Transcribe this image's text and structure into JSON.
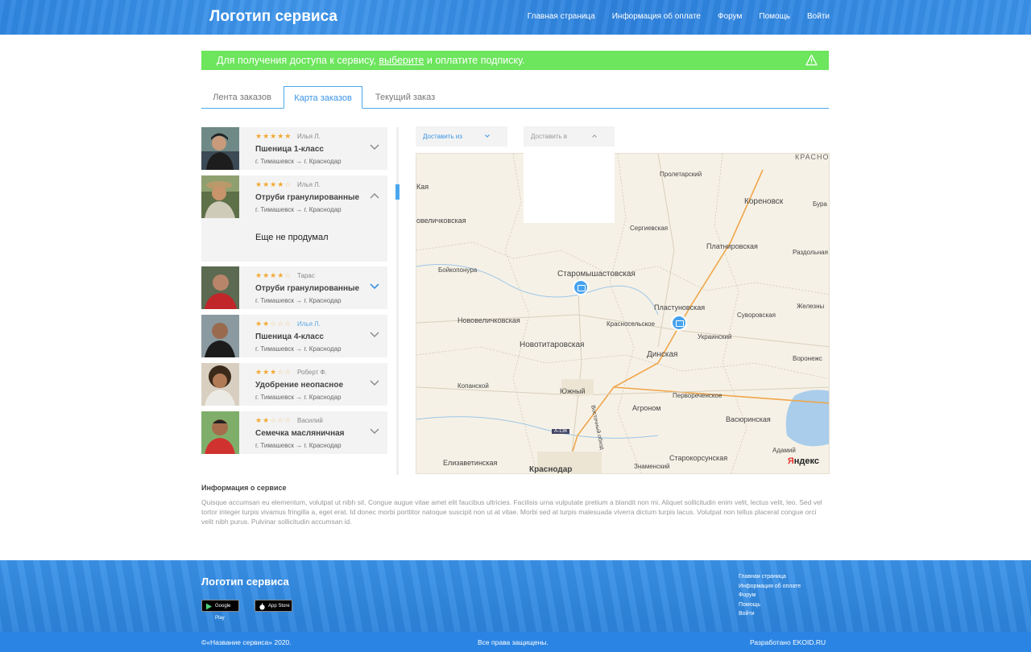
{
  "header": {
    "logo": "Логотип сервиса",
    "nav": [
      "Главная страница",
      "Информация об оплате",
      "Форум",
      "Помощь",
      "Войти"
    ]
  },
  "alert": {
    "text_before": "Для получения доступа к сервису, ",
    "link": "выберите",
    "text_after": " и оплатите подписку.",
    "icon": "warning-icon"
  },
  "tabs": [
    "Лента заказов",
    "Карта заказов",
    "Текущий заказ"
  ],
  "active_tab": "Карта заказов",
  "orders": [
    {
      "rating": 5,
      "author": "Илья Л.",
      "cargo": "Пшеница 1-класс",
      "from": "г. Тимашевск",
      "to": "г. Краснодар",
      "expanded": false
    },
    {
      "rating": 4,
      "author": "Илья Л.",
      "cargo": "Отруби гранулированные",
      "from": "г. Тимашевск",
      "to": "г. Краснодар",
      "expanded": true,
      "note": "Еще не продумал"
    },
    {
      "rating": 4,
      "author": "Тарас",
      "cargo": "Отруби гранулированные",
      "from": "г. Тимашевск",
      "to": "г. Краснодар",
      "expanded": false
    },
    {
      "rating": 2,
      "author": "Илья Л.",
      "cargo": "Пшеница 4-класс",
      "from": "г. Тимашевск",
      "to": "г. Краснодар",
      "expanded": false
    },
    {
      "rating": 3,
      "author": "Роберт Ф.",
      "cargo": "Удобрение неопасное",
      "from": "г. Тимашевск",
      "to": "г. Краснодар",
      "expanded": false
    },
    {
      "rating": 2,
      "author": "Василий",
      "cargo": "Семечка масляничная",
      "from": "г. Тимашевск",
      "to": "г. Краснодар",
      "expanded": false
    }
  ],
  "filters": {
    "from_label": "Доставить из",
    "to_label": "Доставить в"
  },
  "map": {
    "labels": [
      "КРАСНОДА",
      "Пролетарский",
      "Кореновск",
      "Бура",
      "Сергиевская",
      "Платнировская",
      "Раздольная",
      "Старомышастовская",
      "Бойкопонура",
      "Пластуновская",
      "Суворовская",
      "Железны",
      "Красносельское",
      "Украинский",
      "Нововеличковская",
      "Новотитаровская",
      "Динская",
      "Воронежс",
      "Копанской",
      "Южный",
      "Первореченское",
      "Агроном",
      "Васюринская",
      "Адамий",
      "Старокорсунская",
      "Знаменский",
      "Елизаветинская",
      "Краснодар",
      "Восточный обход",
      "А-136",
      "Кая",
      "овеличковская"
    ],
    "provider": "Яндекс"
  },
  "info": {
    "title": "Информация о сервисе",
    "text": "Quisque accumsan eu elementum, volutpat ut nibh sit. Congue augue vitae amet elit faucibus ultricies. Facilisis urna vulputate pretium a blandit non mi. Aliquet sollicitudin enim velit, lectus velit, leo. Sed vel tortor integer turpis vivamus fringilla a, eget erat. Id donec morbi porttitor natoque suscipit non ut at vitae. Morbi sed at turpis malesuada viverra dictum turpis lacus. Volutpat non tellus placerat congue orci velit nibh purus. Pulvinar sollicitudin accumsan id."
  },
  "footer": {
    "logo": "Логотип сервиса",
    "google_play": "Google Play",
    "app_store": "App Store",
    "nav": [
      "Главная страница",
      "Информация об оплате",
      "Форум",
      "Помощь",
      "Войти"
    ],
    "copyright": "©«Название сервиса» 2020.",
    "rights": "Все права защищены.",
    "developer": "Разработано EKOID.RU"
  },
  "colors": {
    "primary": "#3a94e4",
    "alert": "#6de55d",
    "star": "#f2a832",
    "pin": "#46a2ee"
  }
}
